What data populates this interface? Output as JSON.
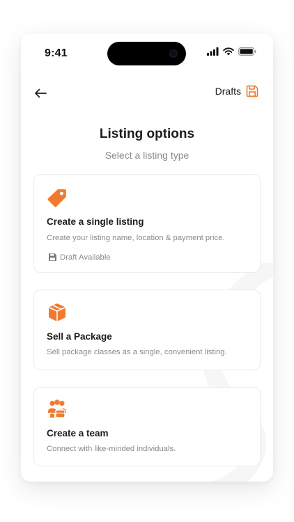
{
  "status_bar": {
    "time": "9:41",
    "icons": [
      "signal-icon",
      "wifi-icon",
      "battery-icon"
    ]
  },
  "nav": {
    "back_icon": "arrow-left-icon",
    "drafts_label": "Drafts",
    "drafts_icon": "save-floppy-icon"
  },
  "header": {
    "title": "Listing options",
    "subtitle": "Select a listing type"
  },
  "options": [
    {
      "icon": "tag-icon",
      "title": "Create a single listing",
      "description": "Create your listing name, location & payment price.",
      "badge": {
        "icon": "floppy-disk-icon",
        "label": "Draft Available"
      }
    },
    {
      "icon": "package-box-icon",
      "title": "Sell a Package",
      "description": "Sell package classes as a single, convenient listing."
    },
    {
      "icon": "team-icon",
      "title": "Create a team",
      "description": "Connect with like-minded individuals."
    }
  ],
  "colors": {
    "accent": "#F07A30",
    "text_primary": "#1C1C1C",
    "text_secondary": "#8A8A8A",
    "card_border": "#ECECEC"
  }
}
